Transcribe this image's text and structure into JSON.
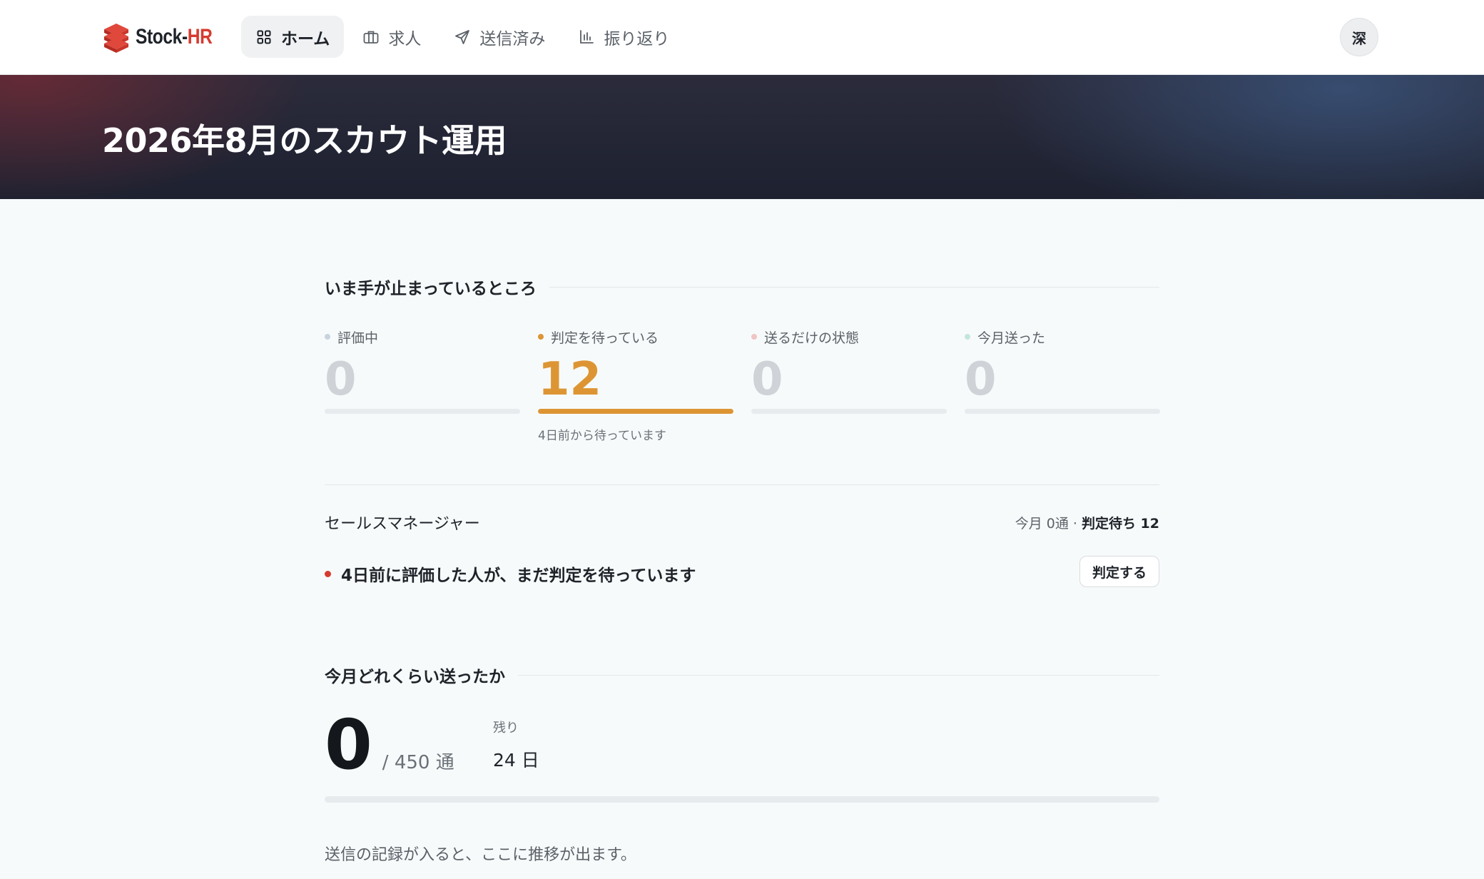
{
  "header": {
    "logo_part1": "Stock-",
    "logo_part2": "HR",
    "nav": [
      {
        "label": "ホーム",
        "icon": "grid-icon",
        "active": true
      },
      {
        "label": "求人",
        "icon": "briefcase-icon",
        "active": false
      },
      {
        "label": "送信済み",
        "icon": "send-icon",
        "active": false
      },
      {
        "label": "振り返り",
        "icon": "bar-chart-icon",
        "active": false
      }
    ],
    "avatar": "深"
  },
  "hero": {
    "title": "2026年8月のスカウト運用"
  },
  "stuck": {
    "heading": "いま手が止まっているところ",
    "stats": [
      {
        "label": "評価中",
        "value": "0",
        "dot_color": "#c8d3de",
        "fill": 0
      },
      {
        "label": "判定を待っている",
        "value": "12",
        "dot_color": "#dd9534",
        "fill": 1,
        "note": "4日前から待っています"
      },
      {
        "label": "送るだけの状態",
        "value": "0",
        "dot_color": "#f0c4c4",
        "fill": 0
      },
      {
        "label": "今月送った",
        "value": "0",
        "dot_color": "#c3e6dc",
        "fill": 0
      }
    ]
  },
  "job": {
    "name": "セールスマネージャー",
    "meta_prefix": "今月 0通 · ",
    "meta_bold": "判定待ち 12",
    "alert": "4日前に評価した人が、まだ判定を待っています",
    "action": "判定する"
  },
  "monthly": {
    "heading": "今月どれくらい送ったか",
    "sent": "0",
    "total": "/ 450 通",
    "remaining_label": "残り",
    "remaining_value": "24 日",
    "progress": 0,
    "empty_note": "送信の記録が入ると、ここに推移が出ます。"
  }
}
